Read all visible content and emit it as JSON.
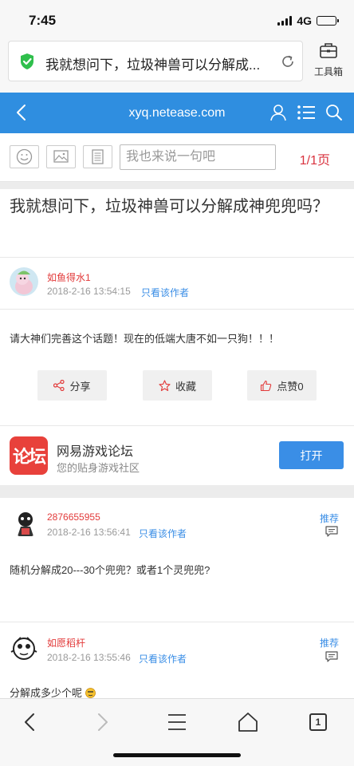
{
  "status_bar": {
    "time": "7:45",
    "network": "4G"
  },
  "browser": {
    "url_title": "我就想问下，垃圾神兽可以分解成...",
    "toolbox_label": "工具箱"
  },
  "site_header": {
    "domain": "xyq.netease.com"
  },
  "reply_bar": {
    "input_placeholder": "我也来说一句吧",
    "page_indicator": "1/1页"
  },
  "thread": {
    "title": "我就想问下，垃圾神兽可以分解成神兜兜吗？"
  },
  "posts": [
    {
      "author": "如鱼得水1",
      "time": "2018-2-16 13:54:15",
      "only_author": "只看该作者",
      "body": "请大神们完善这个话题！现在的低端大唐不如一只狗！！！"
    },
    {
      "author": "2876655955",
      "time": "2018-2-16 13:56:41",
      "only_author": "只看该作者",
      "recommend": "推荐",
      "body": "随机分解成20---30个兜兜？或者1个灵兜兜?"
    },
    {
      "author": "如愿稻杆",
      "time": "2018-2-16 13:55:46",
      "only_author": "只看该作者",
      "recommend": "推荐",
      "body": "分解成多少个呢"
    }
  ],
  "actions": {
    "share": "分享",
    "favorite": "收藏",
    "like": "点赞0"
  },
  "app_banner": {
    "logo_text": "论坛",
    "name": "网易游戏论坛",
    "tagline": "您的贴身游戏社区",
    "open_label": "打开"
  },
  "bottom_nav": {
    "tab_count": "1"
  },
  "colors": {
    "header_blue": "#2f8ee0",
    "author_red": "#e23a3a",
    "link_blue": "#3a8ee6",
    "page_red": "#d9333f"
  }
}
